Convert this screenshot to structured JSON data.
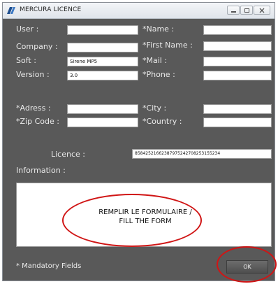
{
  "window": {
    "title": "MERCURA LICENCE",
    "icon": "app-icon"
  },
  "form": {
    "labels": {
      "user": "User :",
      "company": "Company :",
      "soft": "Soft :",
      "version": "Version :",
      "name": "*Name :",
      "first_name": "*First Name :",
      "mail": "*Mail :",
      "phone": "*Phone :",
      "adress": "*Adress :",
      "city": "*City :",
      "zip_code": "*Zip Code :",
      "country": "*Country :",
      "licence": "Licence :",
      "information": "Information :"
    },
    "values": {
      "user": "",
      "company": "",
      "soft": "Sirene MP5",
      "version": "3.0",
      "name": "",
      "first_name": "",
      "mail": "",
      "phone": "",
      "adress": "",
      "city": "",
      "zip_code": "",
      "country": "",
      "licence": "85842521662387975242708253155234"
    },
    "information_text": ""
  },
  "annotation": {
    "line1": "REMPLIR  LE FORMULAIRE  /",
    "line2": "FILL THE FORM",
    "color": "#d01515"
  },
  "footer": {
    "mandatory_note": "* Mandatory Fields",
    "ok_label": "OK"
  }
}
